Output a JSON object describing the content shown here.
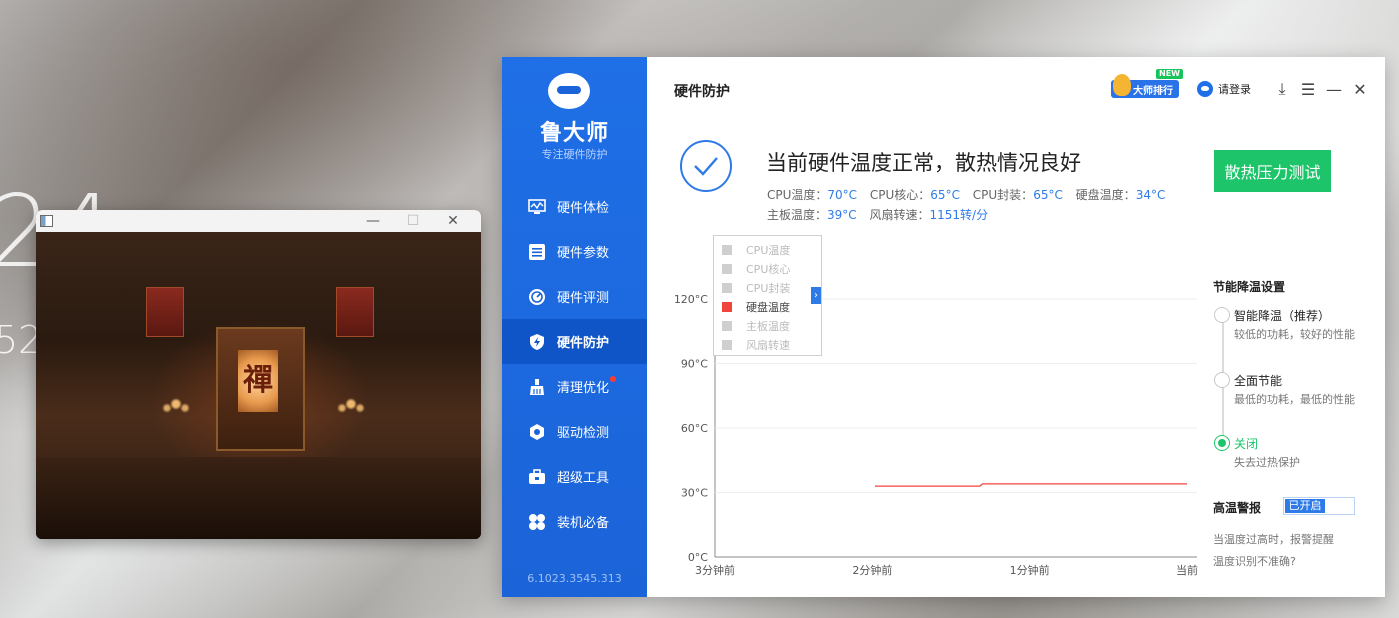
{
  "desktop": {
    "clock_main": "24",
    "clock_sub": "52"
  },
  "viewer": {
    "plaque_text": "禪",
    "controls": {
      "minimize": "—",
      "maximize": "☐",
      "close": "✕"
    }
  },
  "app": {
    "brand": {
      "name": "鲁大师",
      "tagline": "专注硬件防护"
    },
    "nav": [
      {
        "label": "硬件体检",
        "icon": "monitor-icon"
      },
      {
        "label": "硬件参数",
        "icon": "list-icon"
      },
      {
        "label": "硬件评测",
        "icon": "gauge-icon"
      },
      {
        "label": "硬件防护",
        "icon": "shield-icon",
        "active": true
      },
      {
        "label": "清理优化",
        "icon": "broom-icon",
        "badge": true
      },
      {
        "label": "驱动检测",
        "icon": "gear-icon"
      },
      {
        "label": "超级工具",
        "icon": "toolbox-icon"
      },
      {
        "label": "装机必备",
        "icon": "apps-icon"
      }
    ],
    "version": "6.1023.3545.313",
    "page_title": "硬件防护",
    "topbar": {
      "rank_label": "大师排行",
      "new_badge": "NEW",
      "login_label": "请登录",
      "download": "⤓",
      "menu": "☰",
      "minimize": "—",
      "close": "✕"
    },
    "status": {
      "title": "当前硬件温度正常，散热情况良好",
      "line1": [
        {
          "label": "CPU温度：",
          "value": "70°C"
        },
        {
          "label": "CPU核心：",
          "value": "65°C"
        },
        {
          "label": "CPU封装：",
          "value": "65°C"
        },
        {
          "label": "硬盘温度：",
          "value": "34°C"
        }
      ],
      "line2": [
        {
          "label": "主板温度：",
          "value": "39°C"
        },
        {
          "label": "风扇转速：",
          "value": "1151转/分"
        }
      ]
    },
    "stress_button": "散热压力测试",
    "legend": [
      {
        "label": "CPU温度",
        "on": false
      },
      {
        "label": "CPU核心",
        "on": false
      },
      {
        "label": "CPU封装",
        "on": false
      },
      {
        "label": "硬盘温度",
        "on": true
      },
      {
        "label": "主板温度",
        "on": false
      },
      {
        "label": "风扇转速",
        "on": false
      }
    ],
    "legend_tab": "›",
    "settings": {
      "title": "节能降温设置",
      "options": [
        {
          "label": "智能降温（推荐）",
          "desc": "较低的功耗，较好的性能",
          "checked": false
        },
        {
          "label": "全面节能",
          "desc": "最低的功耗，最低的性能",
          "checked": false
        },
        {
          "label": "关闭",
          "desc": "失去过热保护",
          "checked": true
        }
      ],
      "alarm_title": "高温警报",
      "alarm_toggle": "已开启",
      "alarm_desc": "当温度过高时，报警提醒",
      "alarm_link": "温度识别不准确?"
    }
  },
  "chart_data": {
    "type": "line",
    "title": "",
    "xlabel": "",
    "ylabel": "",
    "x_ticks": [
      "3分钟前",
      "2分钟前",
      "1分钟前",
      "当前"
    ],
    "y_ticks": [
      "0°C",
      "30°C",
      "60°C",
      "90°C",
      "120°C"
    ],
    "xlim": [
      -180,
      0
    ],
    "ylim": [
      0,
      120
    ],
    "grid": true,
    "legend_position": "top-left",
    "series": [
      {
        "name": "硬盘温度",
        "color": "#f0443c",
        "x": [
          -119,
          -79,
          -78,
          0
        ],
        "y": [
          33,
          33,
          34,
          34
        ]
      }
    ]
  }
}
